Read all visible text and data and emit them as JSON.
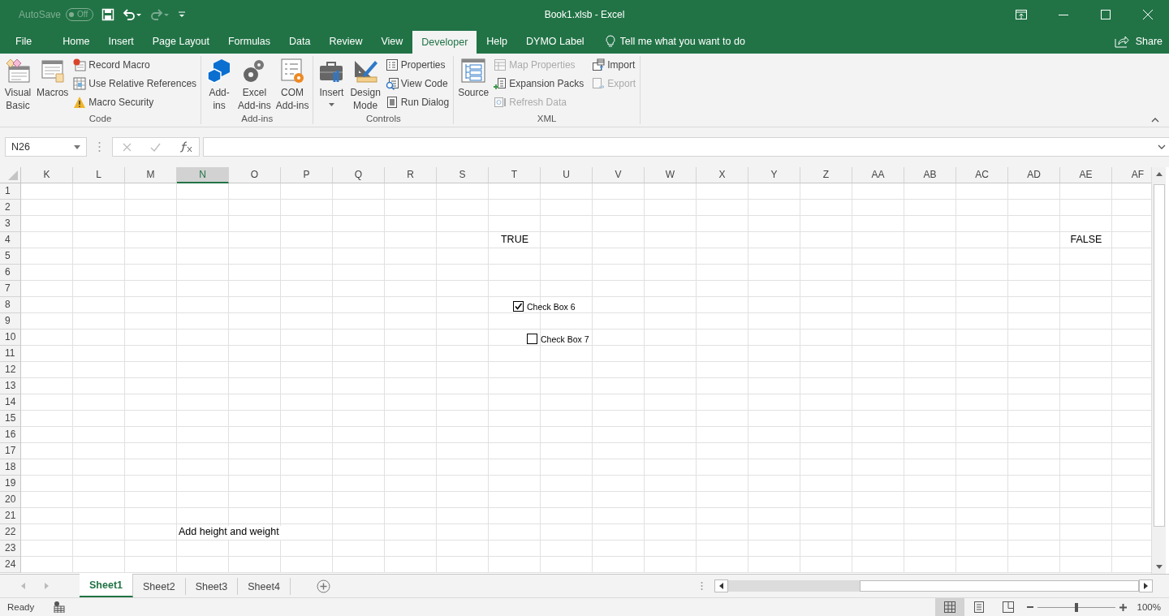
{
  "title_bar": {
    "autosave": {
      "label": "AutoSave",
      "toggle": "Off",
      "on": false
    },
    "title": "Book1.xlsb  -  Excel"
  },
  "ribbon_tabs": [
    {
      "label": "File",
      "selected": false
    },
    {
      "label": "Home",
      "selected": false
    },
    {
      "label": "Insert",
      "selected": false
    },
    {
      "label": "Page Layout",
      "selected": false
    },
    {
      "label": "Formulas",
      "selected": false
    },
    {
      "label": "Data",
      "selected": false
    },
    {
      "label": "Review",
      "selected": false
    },
    {
      "label": "View",
      "selected": false
    },
    {
      "label": "Developer",
      "selected": true
    },
    {
      "label": "Help",
      "selected": false
    },
    {
      "label": "DYMO Label",
      "selected": false
    }
  ],
  "tell_me": {
    "placeholder": "Tell me what you want to do"
  },
  "share": {
    "label": "Share"
  },
  "ribbon_groups": [
    {
      "label": "Code",
      "items": [
        {
          "kind": "large",
          "label": "Visual\nBasic",
          "dropdown": false,
          "disabled": false
        },
        {
          "kind": "large",
          "label": "Macros",
          "dropdown": false,
          "disabled": false
        },
        {
          "kind": "small",
          "label": "Record Macro",
          "disabled": false
        },
        {
          "kind": "small",
          "label": "Use Relative References",
          "disabled": false
        },
        {
          "kind": "small",
          "label": "Macro Security",
          "disabled": false
        }
      ]
    },
    {
      "label": "Add-ins",
      "items": [
        {
          "kind": "large",
          "label": "Add-\nins",
          "dropdown": false,
          "disabled": false
        },
        {
          "kind": "large",
          "label": "Excel\nAdd-ins",
          "dropdown": false,
          "disabled": false
        },
        {
          "kind": "large",
          "label": "COM\nAdd-ins",
          "dropdown": false,
          "disabled": false
        }
      ]
    },
    {
      "label": "Controls",
      "items": [
        {
          "kind": "large",
          "label": "Insert",
          "dropdown": true,
          "disabled": false
        },
        {
          "kind": "large",
          "label": "Design\nMode",
          "dropdown": false,
          "disabled": false
        },
        {
          "kind": "small",
          "label": "Properties",
          "disabled": false
        },
        {
          "kind": "small",
          "label": "View Code",
          "disabled": false
        },
        {
          "kind": "small",
          "label": "Run Dialog",
          "disabled": false
        }
      ]
    },
    {
      "label": "XML",
      "items": [
        {
          "kind": "large",
          "label": "Source",
          "dropdown": false,
          "disabled": false
        },
        {
          "kind": "small",
          "label": "Map Properties",
          "disabled": true
        },
        {
          "kind": "small",
          "label": "Expansion Packs",
          "disabled": false
        },
        {
          "kind": "small",
          "label": "Refresh Data",
          "disabled": true
        },
        {
          "kind": "small",
          "label": "Import",
          "disabled": false
        },
        {
          "kind": "small",
          "label": "Export",
          "disabled": true
        }
      ]
    }
  ],
  "formula_bar": {
    "name_box": "N26"
  },
  "grid": {
    "columns": [
      {
        "label": "K",
        "selected": false
      },
      {
        "label": "L",
        "selected": false
      },
      {
        "label": "M",
        "selected": false
      },
      {
        "label": "N",
        "selected": true
      },
      {
        "label": "O",
        "selected": false
      },
      {
        "label": "P",
        "selected": false
      },
      {
        "label": "Q",
        "selected": false
      },
      {
        "label": "R",
        "selected": false
      },
      {
        "label": "S",
        "selected": false
      },
      {
        "label": "T",
        "selected": false
      },
      {
        "label": "U",
        "selected": false
      },
      {
        "label": "V",
        "selected": false
      },
      {
        "label": "W",
        "selected": false
      },
      {
        "label": "X",
        "selected": false
      },
      {
        "label": "Y",
        "selected": false
      },
      {
        "label": "Z",
        "selected": false
      },
      {
        "label": "AA",
        "selected": false
      },
      {
        "label": "AB",
        "selected": false
      },
      {
        "label": "AC",
        "selected": false
      },
      {
        "label": "AD",
        "selected": false
      },
      {
        "label": "AE",
        "selected": false
      },
      {
        "label": "AF",
        "selected": false
      }
    ],
    "rows": [
      {
        "label": "1"
      },
      {
        "label": "2"
      },
      {
        "label": "3"
      },
      {
        "label": "4",
        "cells": [
          {},
          {},
          {},
          {},
          {},
          {},
          {},
          {},
          {},
          {
            "kind": "boolean",
            "text": "TRUE"
          },
          {},
          {},
          {},
          {},
          {},
          {},
          {},
          {},
          {},
          {},
          {
            "kind": "boolean",
            "text": "FALSE"
          }
        ]
      },
      {
        "label": "5"
      },
      {
        "label": "6"
      },
      {
        "label": "7"
      },
      {
        "label": "8"
      },
      {
        "label": "9"
      },
      {
        "label": "10"
      },
      {
        "label": "11"
      },
      {
        "label": "12"
      },
      {
        "label": "13"
      },
      {
        "label": "14"
      },
      {
        "label": "15"
      },
      {
        "label": "16"
      },
      {
        "label": "17"
      },
      {
        "label": "18"
      },
      {
        "label": "19"
      },
      {
        "label": "20"
      },
      {
        "label": "21"
      },
      {
        "label": "22",
        "cells": [
          {},
          {},
          {},
          {
            "kind": "text",
            "text": "Add height and weight"
          }
        ]
      },
      {
        "label": "23"
      },
      {
        "label": "24"
      }
    ]
  },
  "form_controls": [
    {
      "label": "Check Box 6",
      "checked": true
    },
    {
      "label": "Check Box 7",
      "checked": false
    }
  ],
  "sheet_tabs": [
    {
      "label": "Sheet1",
      "selected": true
    },
    {
      "label": "Sheet2",
      "selected": false
    },
    {
      "label": "Sheet3",
      "selected": false
    },
    {
      "label": "Sheet4",
      "selected": false
    }
  ],
  "status_bar": {
    "status": "Ready",
    "views": [
      {
        "selected": true
      },
      {
        "selected": false
      },
      {
        "selected": false
      }
    ],
    "zoom": {
      "level": 0.5,
      "reading": "100%"
    }
  }
}
